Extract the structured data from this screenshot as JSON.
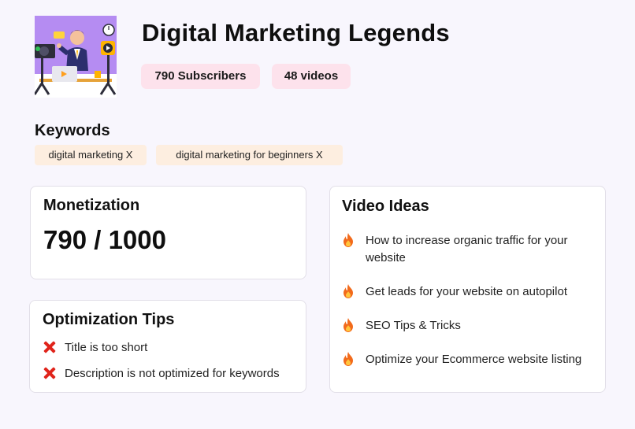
{
  "channel": {
    "title": "Digital Marketing Legends",
    "subscribers": "790 Subscribers",
    "videos": "48 videos"
  },
  "keywords": {
    "heading": "Keywords",
    "items": [
      "digital marketing X",
      "digital marketing for beginners X"
    ]
  },
  "monetization": {
    "heading": "Monetization",
    "value": "790 / 1000"
  },
  "optimization": {
    "heading": "Optimization Tips",
    "tips": [
      "Title is too short",
      "Description is not optimized for keywords"
    ]
  },
  "video_ideas": {
    "heading": "Video Ideas",
    "items": [
      "How to increase organic traffic for your website",
      "Get leads for your website on autopilot",
      "SEO Tips & Tricks",
      "Optimize your Ecommerce website listing"
    ]
  },
  "colors": {
    "background": "#f8f6fd",
    "pill": "#fde2ec",
    "chip": "#fdeee0",
    "thumbnail": "#b58cf2",
    "error": "#e0241b",
    "fire": "#f26a1b"
  },
  "icons": {
    "tip": "cross-mark-icon",
    "idea": "fire-icon"
  }
}
